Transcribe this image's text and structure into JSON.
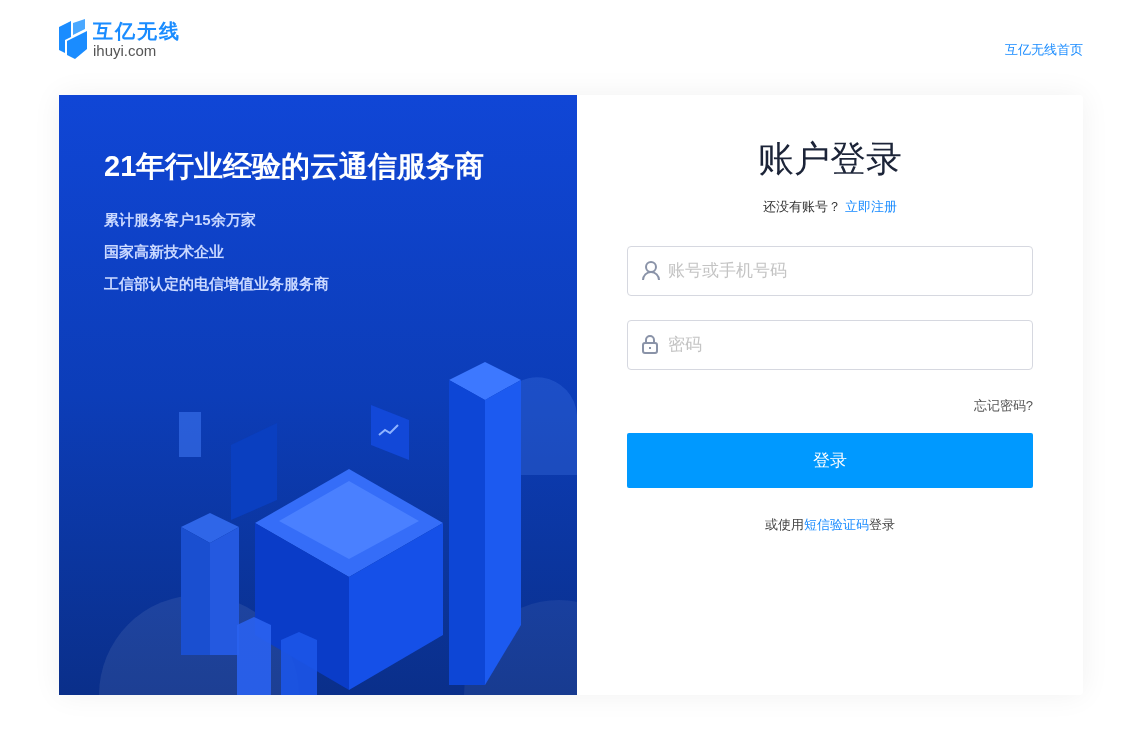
{
  "header": {
    "logo": {
      "name": "互亿无线",
      "domain": "ihuyi.com"
    },
    "home_link": "互亿无线首页"
  },
  "promo": {
    "title": "21年行业经验的云通信服务商",
    "points": [
      "累计服务客户15余万家",
      "国家高新技术企业",
      "工信部认定的电信增值业务服务商"
    ]
  },
  "login": {
    "title": "账户登录",
    "register_prompt": "还没有账号？",
    "register_link": "立即注册",
    "fields": [
      {
        "kind": "account",
        "placeholder": "账号或手机号码"
      },
      {
        "kind": "password",
        "placeholder": "密码"
      }
    ],
    "forgot_link": "忘记密码?",
    "submit": "登录",
    "alt": {
      "prefix": "或使用",
      "link": "短信验证码",
      "suffix": "登录"
    }
  }
}
